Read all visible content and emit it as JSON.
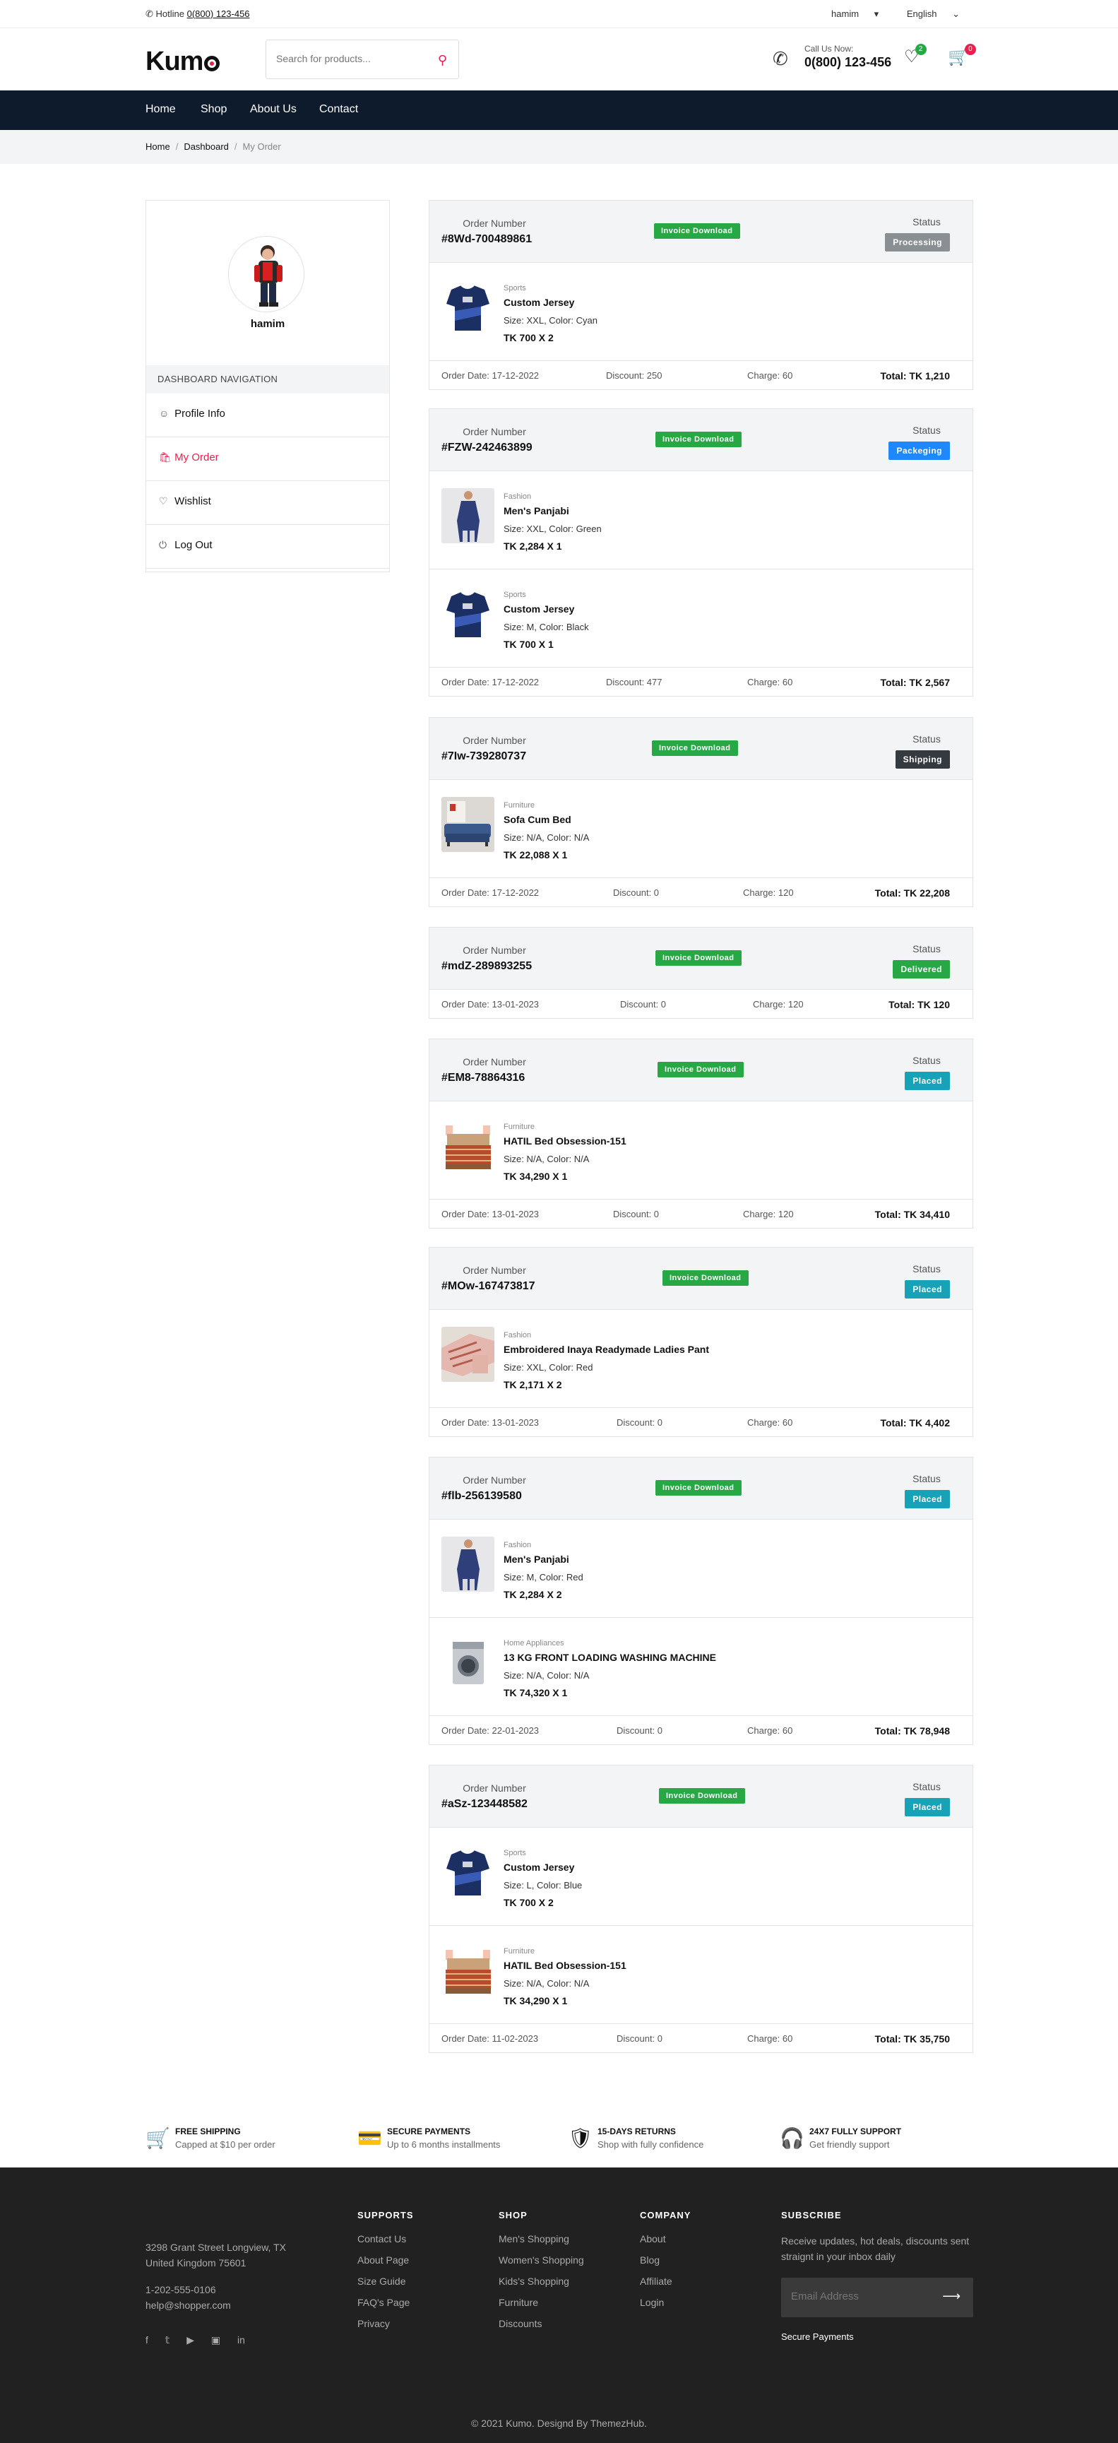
{
  "topbar": {
    "hotline_label": "Hotline",
    "hotline_number": "0(800) 123-456",
    "user": "hamim",
    "language": "English"
  },
  "header": {
    "logo": "Kumo",
    "search_placeholder": "Search for products...",
    "call_label": "Call Us Now:",
    "call_number": "0(800) 123-456",
    "wishlist_count": "2",
    "cart_count": "0"
  },
  "nav": [
    "Home",
    "Shop",
    "About Us",
    "Contact"
  ],
  "breadcrumb": [
    "Home",
    "Dashboard",
    "My Order"
  ],
  "sidebar": {
    "username": "hamim",
    "heading": "DASHBOARD NAVIGATION",
    "items": [
      "Profile Info",
      "My Order",
      "Wishlist",
      "Log Out"
    ]
  },
  "labels": {
    "order_number": "Order Number",
    "status": "Status",
    "invoice": "Invoice Download"
  },
  "orders": [
    {
      "id": "#8Wd-700489861",
      "status": "Processing",
      "status_color": "#8a8f94",
      "items": [
        {
          "cat": "Sports",
          "name": "Custom Jersey",
          "attrs": "Size: XXL, Color: Cyan",
          "price": "TK 700 X 2",
          "img": "jersey"
        }
      ],
      "date": "Order Date: 17-12-2022",
      "discount": "Discount: 250",
      "charge": "Charge: 60",
      "total": "Total: TK 1,210"
    },
    {
      "id": "#FZW-242463899",
      "status": "Packeging",
      "status_color": "#1e88ff",
      "items": [
        {
          "cat": "Fashion",
          "name": "Men's Panjabi",
          "attrs": "Size: XXL, Color: Green",
          "price": "TK 2,284 X 1",
          "img": "panjabi"
        },
        {
          "cat": "Sports",
          "name": "Custom Jersey",
          "attrs": "Size: M, Color: Black",
          "price": "TK 700 X 1",
          "img": "jersey"
        }
      ],
      "date": "Order Date: 17-12-2022",
      "discount": "Discount: 477",
      "charge": "Charge: 60",
      "total": "Total: TK 2,567"
    },
    {
      "id": "#7Iw-739280737",
      "status": "Shipping",
      "status_color": "#343a40",
      "items": [
        {
          "cat": "Furniture",
          "name": "Sofa Cum Bed",
          "attrs": "Size: N/A, Color: N/A",
          "price": "TK 22,088 X 1",
          "img": "sofa"
        }
      ],
      "date": "Order Date: 17-12-2022",
      "discount": "Discount: 0",
      "charge": "Charge: 120",
      "total": "Total: TK 22,208"
    },
    {
      "id": "#mdZ-289893255",
      "status": "Delivered",
      "status_color": "#28a745",
      "items": [],
      "date": "Order Date: 13-01-2023",
      "discount": "Discount: 0",
      "charge": "Charge: 120",
      "total": "Total: TK 120"
    },
    {
      "id": "#EM8-78864316",
      "status": "Placed",
      "status_color": "#17a2b8",
      "items": [
        {
          "cat": "Furniture",
          "name": "HATIL Bed Obsession-151",
          "attrs": "Size: N/A, Color: N/A",
          "price": "TK 34,290 X 1",
          "img": "bed"
        }
      ],
      "date": "Order Date: 13-01-2023",
      "discount": "Discount: 0",
      "charge": "Charge: 120",
      "total": "Total: TK 34,410"
    },
    {
      "id": "#MOw-167473817",
      "status": "Placed",
      "status_color": "#17a2b8",
      "items": [
        {
          "cat": "Fashion",
          "name": "Embroidered Inaya Readymade Ladies Pant",
          "attrs": "Size: XXL, Color: Red",
          "price": "TK 2,171 X 2",
          "img": "pant"
        }
      ],
      "date": "Order Date: 13-01-2023",
      "discount": "Discount: 0",
      "charge": "Charge: 60",
      "total": "Total: TK 4,402"
    },
    {
      "id": "#flb-256139580",
      "status": "Placed",
      "status_color": "#17a2b8",
      "items": [
        {
          "cat": "Fashion",
          "name": "Men's Panjabi",
          "attrs": "Size: M, Color: Red",
          "price": "TK 2,284 X 2",
          "img": "panjabi"
        },
        {
          "cat": "Home Appliances",
          "name": "13 KG FRONT LOADING WASHING MACHINE",
          "attrs": "Size: N/A, Color: N/A",
          "price": "TK 74,320 X 1",
          "img": "washer"
        }
      ],
      "date": "Order Date: 22-01-2023",
      "discount": "Discount: 0",
      "charge": "Charge: 60",
      "total": "Total: TK 78,948"
    },
    {
      "id": "#aSz-123448582",
      "status": "Placed",
      "status_color": "#17a2b8",
      "items": [
        {
          "cat": "Sports",
          "name": "Custom Jersey",
          "attrs": "Size: L, Color: Blue",
          "price": "TK 700 X 2",
          "img": "jersey"
        },
        {
          "cat": "Furniture",
          "name": "HATIL Bed Obsession-151",
          "attrs": "Size: N/A, Color: N/A",
          "price": "TK 34,290 X 1",
          "img": "bed"
        }
      ],
      "date": "Order Date: 11-02-2023",
      "discount": "Discount: 0",
      "charge": "Charge: 60",
      "total": "Total: TK 35,750"
    }
  ],
  "features": [
    {
      "title": "FREE SHIPPING",
      "sub": "Capped at $10 per order",
      "icon": "basket-icon"
    },
    {
      "title": "SECURE PAYMENTS",
      "sub": "Up to 6 months installments",
      "icon": "card-icon"
    },
    {
      "title": "15-DAYS RETURNS",
      "sub": "Shop with fully confidence",
      "icon": "shield-icon"
    },
    {
      "title": "24X7 FULLY SUPPORT",
      "sub": "Get friendly support",
      "icon": "headset-icon"
    }
  ],
  "footer": {
    "address": [
      "3298 Grant Street Longview, TX",
      "United Kingdom 75601"
    ],
    "phone": "1-202-555-0106",
    "email": "help@shopper.com",
    "supports": {
      "title": "SUPPORTS",
      "links": [
        "Contact Us",
        "About Page",
        "Size Guide",
        "FAQ's Page",
        "Privacy"
      ]
    },
    "shop": {
      "title": "SHOP",
      "links": [
        "Men's Shopping",
        "Women's Shopping",
        "Kids's Shopping",
        "Furniture",
        "Discounts"
      ]
    },
    "company": {
      "title": "COMPANY",
      "links": [
        "About",
        "Blog",
        "Affiliate",
        "Login"
      ]
    },
    "subscribe": {
      "title": "SUBSCRIBE",
      "text": [
        "Receive updates, hot deals, discounts sent",
        "straignt in your inbox daily"
      ],
      "placeholder": "Email Address",
      "secure": "Secure Payments"
    },
    "copyright": "© 2021 Kumo. Designd By ThemezHub."
  },
  "colors": {
    "accent": "#e4224f",
    "nav_bg": "#0e1b2c",
    "footer_bg": "#212121",
    "invoice": "#28a745"
  }
}
